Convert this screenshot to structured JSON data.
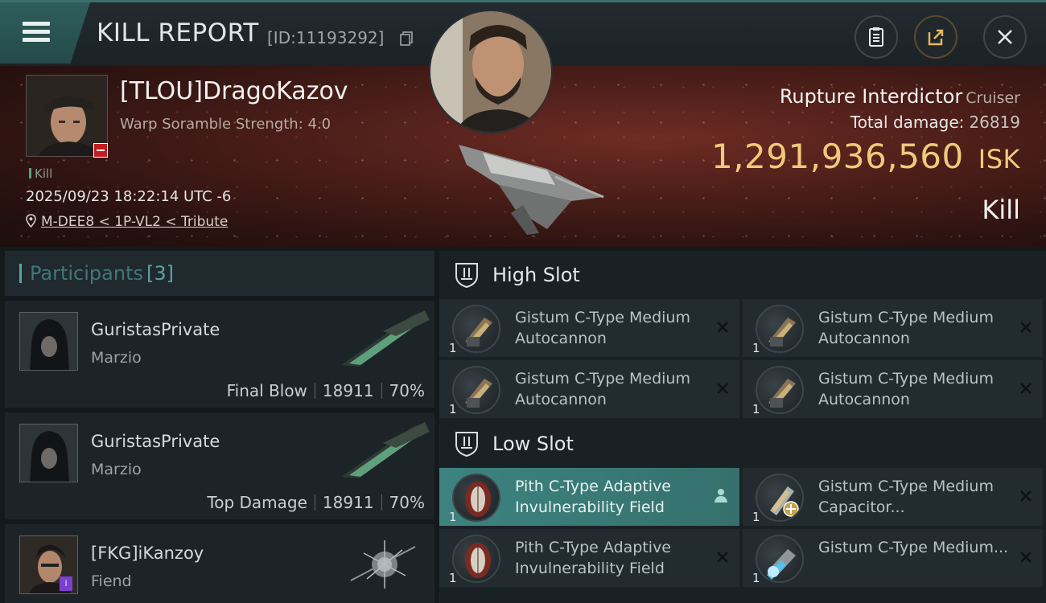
{
  "header": {
    "title": "KILL REPORT",
    "report_id": "[ID:11193292]"
  },
  "victim": {
    "name": "[TLOU]DragoKazov",
    "subtitle": "Warp Soramble Strength: 4.0",
    "tag": "Kill",
    "timestamp": "2025/09/23 18:22:14 UTC -6",
    "location": "M-DEE8 < 1P-VL2 < Tribute"
  },
  "ship": {
    "name": "Rupture Interdictor",
    "class": "Cruiser",
    "damage_label": "Total damage:",
    "damage_value": "26819",
    "isk_value": "1,291,936,560",
    "isk_unit": "ISK",
    "result": "Kill"
  },
  "participants": {
    "label": "Participants",
    "count": "[3]",
    "rows": [
      {
        "name": "GuristasPrivate",
        "corp": "Marzio",
        "role": "Final Blow",
        "damage": "18911",
        "percent": "70%"
      },
      {
        "name": "GuristasPrivate",
        "corp": "Marzio",
        "role": "Top Damage",
        "damage": "18911",
        "percent": "70%"
      },
      {
        "name": "[FKG]iKanzoy",
        "corp": "Fiend",
        "role": "",
        "damage": "",
        "percent": ""
      }
    ]
  },
  "slots": {
    "high": {
      "label": "High Slot",
      "items": [
        {
          "qty": "1",
          "name": "Gistum C-Type Medium Autocannon"
        },
        {
          "qty": "1",
          "name": "Gistum C-Type Medium Autocannon"
        },
        {
          "qty": "1",
          "name": "Gistum C-Type Medium Autocannon"
        },
        {
          "qty": "1",
          "name": "Gistum C-Type Medium Autocannon"
        }
      ]
    },
    "low": {
      "label": "Low Slot",
      "items": [
        {
          "qty": "1",
          "name": "Pith C-Type Adaptive Invulnerability Field"
        },
        {
          "qty": "1",
          "name": "Gistum C-Type Medium Capacitor..."
        },
        {
          "qty": "1",
          "name": "Pith C-Type Adaptive Invulnerability Field"
        },
        {
          "qty": "1",
          "name": "Gistum C-Type Medium..."
        }
      ]
    }
  },
  "colors": {
    "accent_teal": "#3d8380",
    "isk_gold": "#f1c97b",
    "hero_red": "#6e2c24",
    "negative_badge": "#c21d22"
  }
}
